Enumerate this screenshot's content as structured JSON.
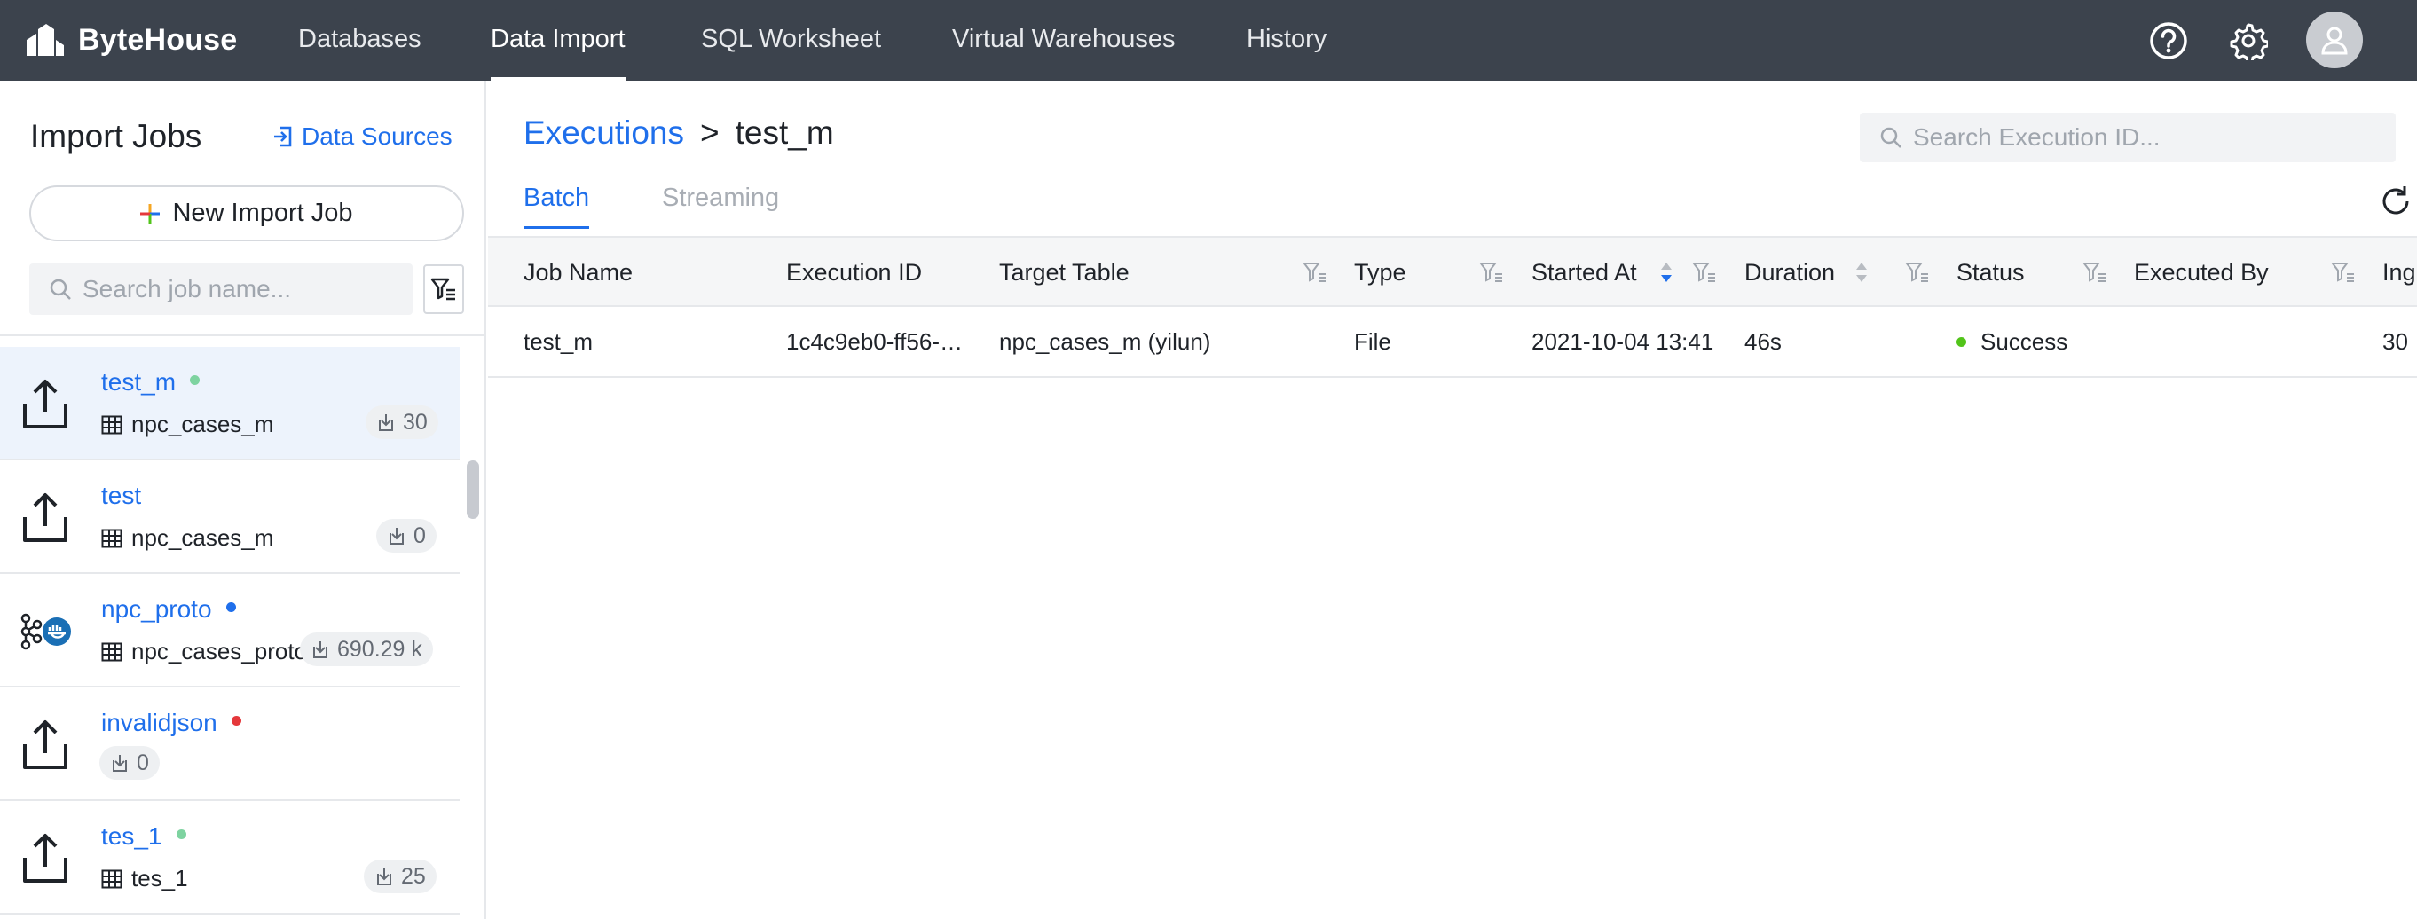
{
  "app": {
    "name": "ByteHouse",
    "nav": [
      {
        "label": "Databases",
        "active": false
      },
      {
        "label": "Data Import",
        "active": true
      },
      {
        "label": "SQL Worksheet",
        "active": false
      },
      {
        "label": "Virtual Warehouses",
        "active": false
      },
      {
        "label": "History",
        "active": false
      }
    ],
    "icons": {
      "help": "help-circle-icon",
      "settings": "gear-icon",
      "avatar": "user-icon"
    }
  },
  "sidebar": {
    "title": "Import Jobs",
    "data_sources_label": "Data Sources",
    "new_job_label": "New Import Job",
    "search_placeholder": "Search job name...",
    "jobs": [
      {
        "name": "test_m",
        "status_color": "#7ed3a0",
        "table": "npc_cases_m",
        "count": "30",
        "icon": "upload-icon",
        "selected": true
      },
      {
        "name": "test",
        "status_color": "",
        "table": "npc_cases_m",
        "count": "0",
        "icon": "upload-icon",
        "selected": false
      },
      {
        "name": "npc_proto",
        "status_color": "#1f6feb",
        "table": "npc_cases_proto",
        "count": "690.29 k",
        "icon": "kafka-icon",
        "selected": false
      },
      {
        "name": "invalidjson",
        "status_color": "#e5383b",
        "table": "",
        "count": "0",
        "icon": "upload-icon",
        "selected": false
      },
      {
        "name": "tes_1",
        "status_color": "#7ed3a0",
        "table": "tes_1",
        "count": "25",
        "icon": "upload-icon",
        "selected": false
      }
    ]
  },
  "main": {
    "breadcrumb": {
      "parent": "Executions",
      "separator": ">",
      "current": "test_m"
    },
    "search_placeholder": "Search Execution ID...",
    "tabs": [
      {
        "label": "Batch",
        "active": true
      },
      {
        "label": "Streaming",
        "active": false
      }
    ],
    "columns": [
      "Job Name",
      "Execution ID",
      "Target Table",
      "Type",
      "Started At",
      "Duration",
      "Status",
      "Executed By",
      "Ing"
    ],
    "rows": [
      {
        "job_name": "test_m",
        "execution_id": "1c4c9eb0-ff56-…",
        "target_table": "npc_cases_m (yilun)",
        "type": "File",
        "started_at": "2021-10-04 13:41",
        "duration": "46s",
        "status": "Success",
        "status_color": "#52c41a",
        "executed_by": "",
        "ingested": "30"
      }
    ]
  }
}
